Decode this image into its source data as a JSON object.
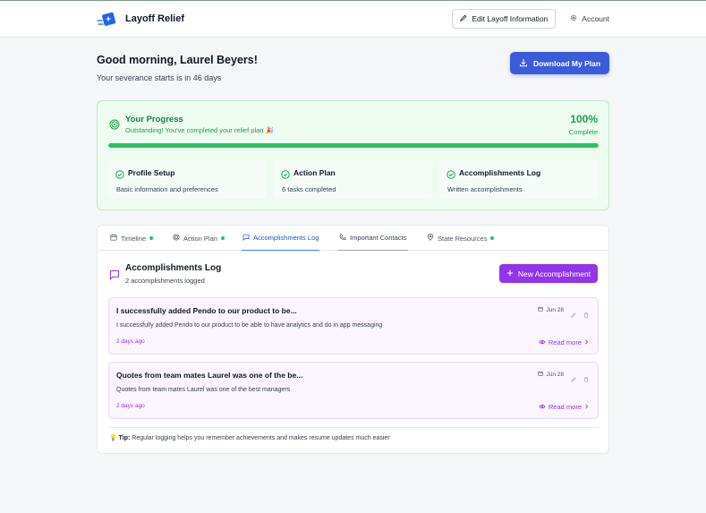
{
  "header": {
    "brand": "Layoff Relief",
    "edit_label": "Edit Layoff Information",
    "account_label": "Account"
  },
  "greeting": {
    "title": "Good morning, Laurel Beyers!",
    "subtitle": "Your severance starts is in 46 days",
    "download_label": "Download My Plan"
  },
  "progress": {
    "title": "Your Progress",
    "subtitle": "Outstanding! You've completed your relief plan 🎉",
    "percent_text": "100%",
    "percent_label": "Complete",
    "fraction": 1.0,
    "steps": [
      {
        "title": "Profile Setup",
        "desc": "Basic information and preferences"
      },
      {
        "title": "Action Plan",
        "desc": "6 tasks completed"
      },
      {
        "title": "Accomplishments Log",
        "desc": "Written accomplishments"
      }
    ]
  },
  "tabs": [
    {
      "label": "Timeline",
      "dot": true
    },
    {
      "label": "Action Plan",
      "dot": true
    },
    {
      "label": "Accomplishments Log",
      "dot": false,
      "active": true
    },
    {
      "label": "Important Contacts",
      "dot": false
    },
    {
      "label": "State Resources",
      "dot": true
    }
  ],
  "log": {
    "title": "Accomplishments Log",
    "subtitle": "2 accomplishments logged",
    "new_label": "New Accomplishment",
    "entries": [
      {
        "title": "I successfully added Pendo to our product to be...",
        "body": "I successfully added Pendo to our product to be able to have analytics and do in app messaging",
        "date": "Jun 28",
        "ago": "2 days ago",
        "more": "Read more"
      },
      {
        "title": "Quotes from team mates Laurel was one of the be...",
        "body": "Quotes from team mates Laurel was one of the best managers",
        "date": "Jun 28",
        "ago": "2 days ago",
        "more": "Read more"
      }
    ],
    "tip_label": "Tip:",
    "tip_text": "Regular logging helps you remember achievements and makes resume updates much easier"
  },
  "colors": {
    "primary": "#3b5bdb",
    "success": "#16a34a",
    "purple": "#9333ea"
  }
}
